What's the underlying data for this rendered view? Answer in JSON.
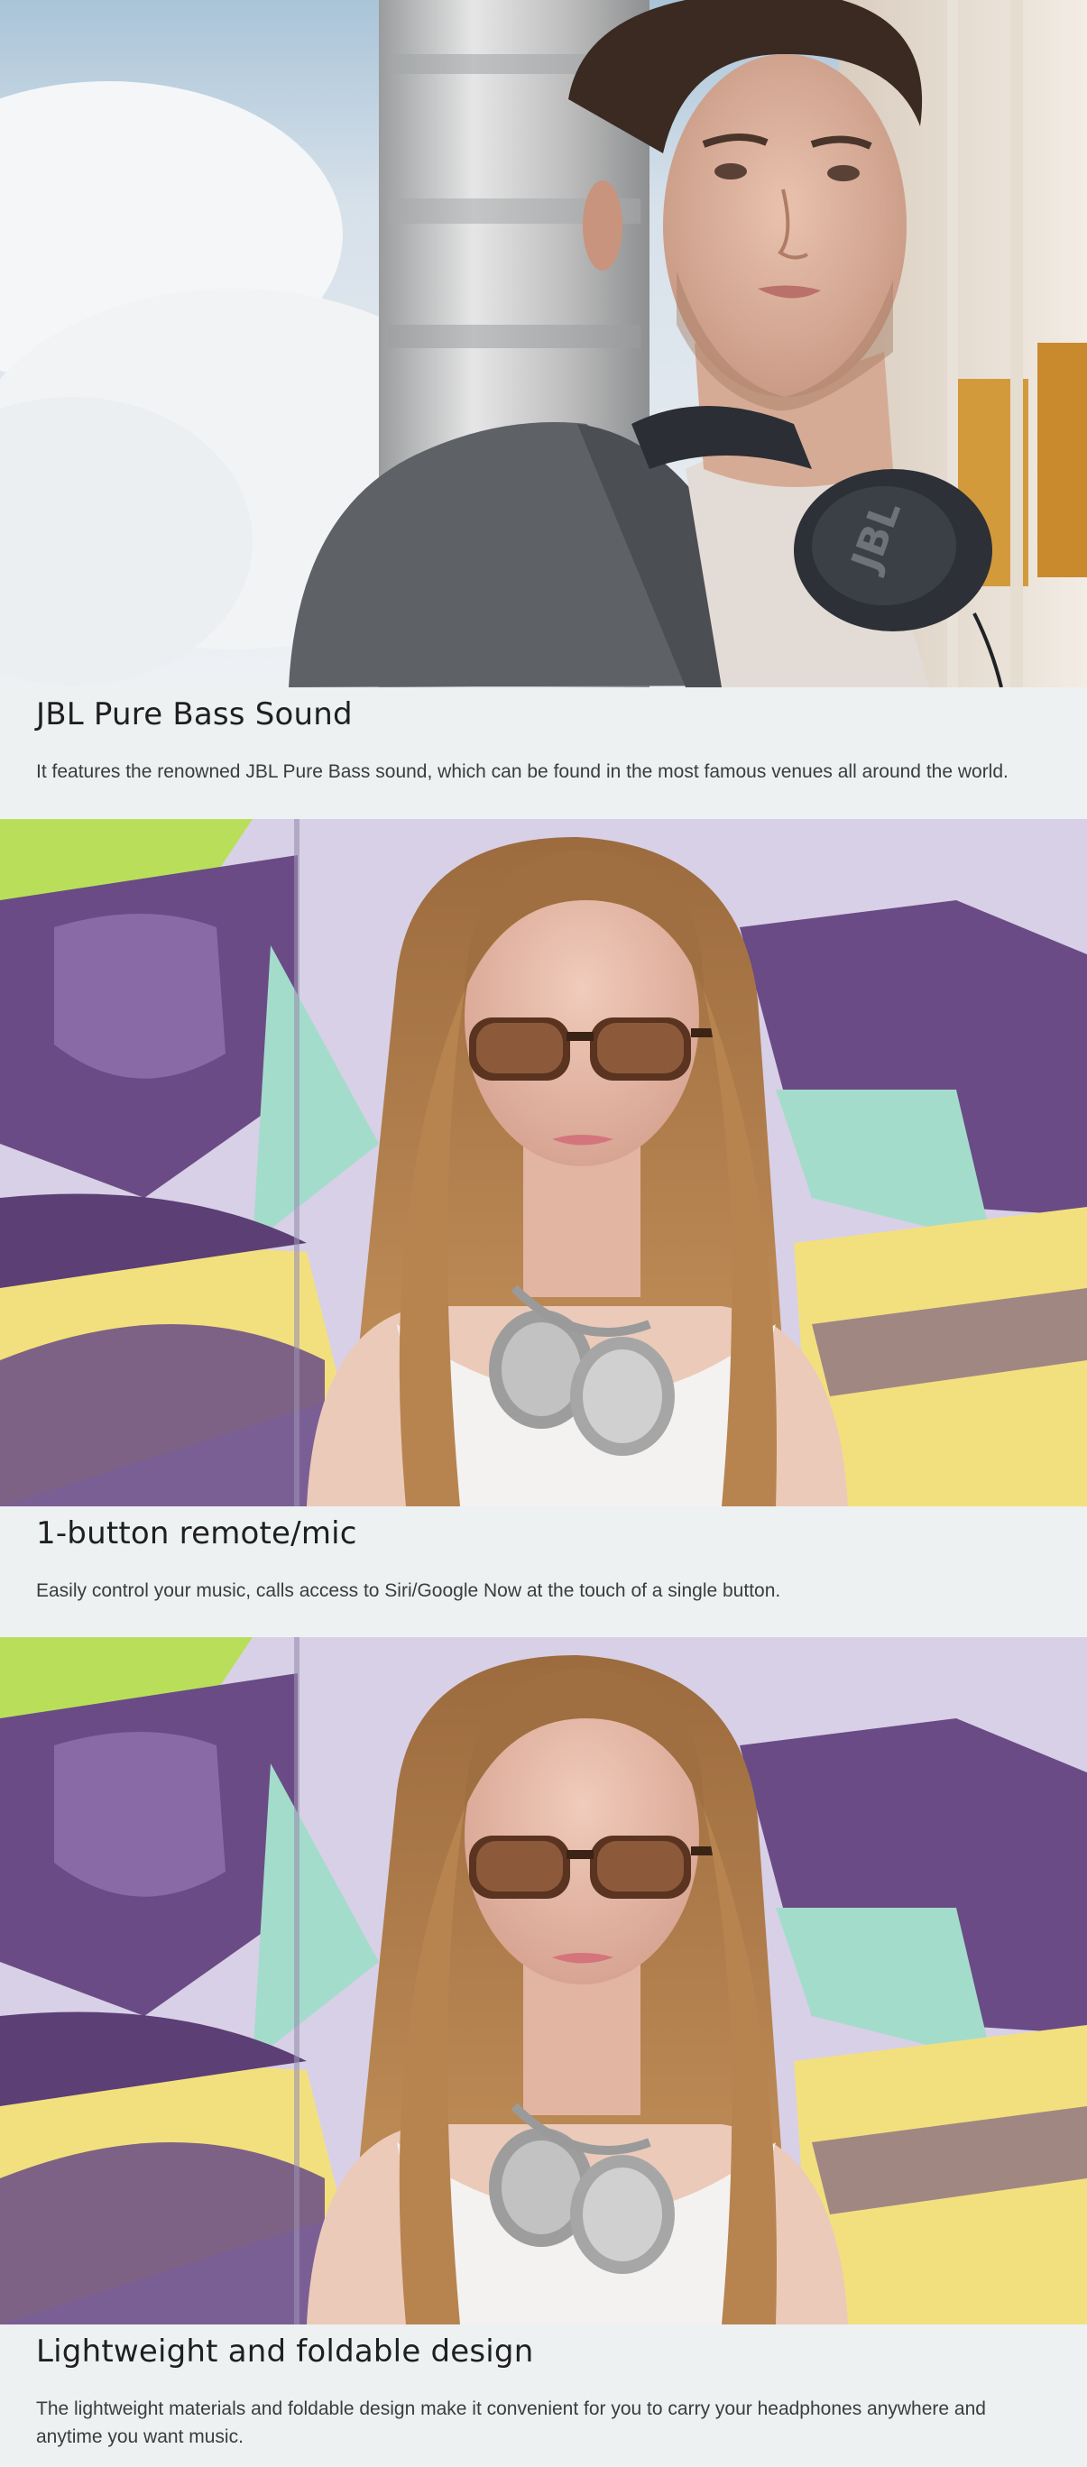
{
  "features": [
    {
      "title": "JBL Pure Bass Sound",
      "description": "It features the renowned JBL Pure Bass sound, which can be found in the most famous venues all around the world.",
      "image": "man-wearing-black-jbl-headphones-around-neck"
    },
    {
      "title": "1-button remote/mic",
      "description": "Easily control your music, calls access to Siri/Google Now at the touch of a single button.",
      "image": "woman-with-sunglasses-and-white-headphones-graffiti-wall"
    },
    {
      "title": "Lightweight and foldable design",
      "description": "The lightweight materials and foldable design make it convenient for you to carry your headphones anywhere and anytime you want music.",
      "image": "woman-with-sunglasses-and-white-headphones-graffiti-wall"
    }
  ],
  "colors": {
    "background": "#edf1f2",
    "title": "#1f1f22",
    "body_text": "#3c3c3c"
  }
}
